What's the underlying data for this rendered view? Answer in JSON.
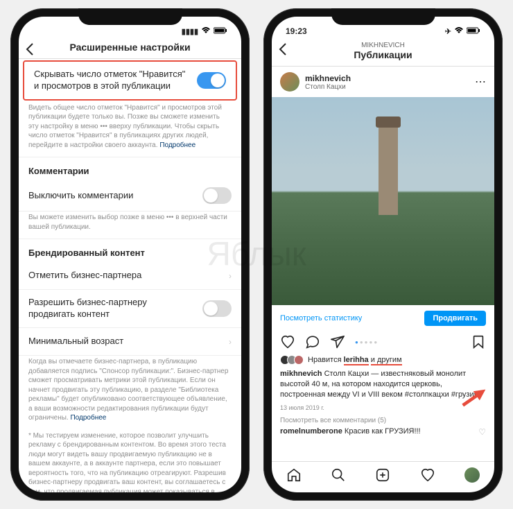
{
  "watermark": "Яблык",
  "left": {
    "status_time": "",
    "header_title": "Расширенные настройки",
    "hide_likes_label": "Скрывать число отметок \"Нравится\" и просмотров в этой публикации",
    "hide_likes_helper": "Видеть общее число отметок \"Нравится\" и просмотров этой публикации будете только вы. Позже вы сможете изменить эту настройку в меню ••• вверху публикации. Чтобы скрыть число отметок \"Нравится\" в публикациях других людей, перейдите в настройки своего аккаунта.",
    "more_link": "Подробнее",
    "comments_section": "Комментарии",
    "disable_comments": "Выключить комментарии",
    "comments_helper": "Вы можете изменить выбор позже в меню ••• в верхней части вашей публикации.",
    "branded_section": "Брендированный контент",
    "tag_partner": "Отметить бизнес-партнера",
    "allow_promote": "Разрешить бизнес-партнеру продвигать контент",
    "min_age": "Минимальный возраст",
    "branded_helper": "Когда вы отмечаете бизнес-партнера, в публикацию добавляется подпись \"Спонсор публикации:\". Бизнес-партнер сможет просматривать метрики этой публикации. Если он начнет продвигать эту публикацию, в разделе \"Библиотека рекламы\" будет опубликовано соответствующее объявление, а ваши возможности редактирования публикации будут ограничены.",
    "test_helper": "* Мы тестируем изменение, которое позволит улучшить рекламу с брендированным контентом. Во время этого теста люди могут видеть вашу продвигаемую публикацию не в вашем аккаунте, а в аккаунте партнера, если это повышает вероятность того, что на публикацию отреагируют. Разрешив бизнес-партнеру продвигать ваш контент, вы соглашаетесь с тем, что продвигаемая публикация может показываться в аккаунте вашего партнера."
  },
  "right": {
    "status_time": "19:23",
    "nav_sub": "MIKHNEVICH",
    "nav_title": "Публикации",
    "username": "mikhnevich",
    "location": "Столп Кацхи",
    "view_stats": "Посмотреть статистику",
    "promote": "Продвигать",
    "likes_prefix": "Нравится",
    "likes_user": "lerihha",
    "likes_suffix": "и другим",
    "caption_user": "mikhnevich",
    "caption_text": "Столп Кацхи — известняковый монолит высотой 40 м, на котором находится церковь, построенная между VI и VIII веком #столпкацхи #грузия",
    "date": "13 июля 2019 г.",
    "view_comments": "Посмотреть все комментарии (5)",
    "comment_user": "romelnumberone",
    "comment_text": "Красив как ГРУЗИЯ!!!"
  }
}
